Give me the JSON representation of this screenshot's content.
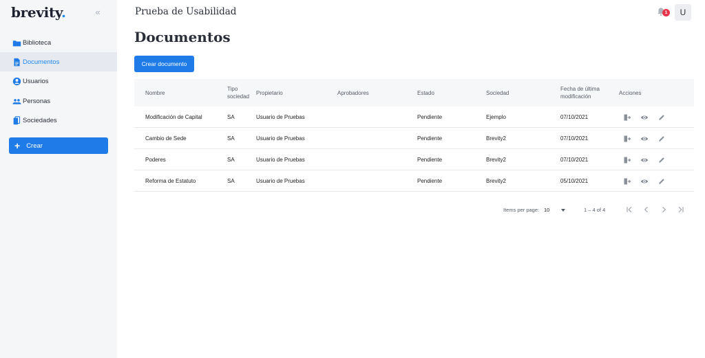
{
  "app": {
    "logo": "brevity",
    "logo_dot": ".",
    "collapse_icon": "«"
  },
  "sidebar": {
    "items": [
      {
        "label": "Biblioteca",
        "icon": "folder-icon"
      },
      {
        "label": "Documentos",
        "icon": "document-icon",
        "active": true
      },
      {
        "label": "Usuarios",
        "icon": "user-circle-icon"
      },
      {
        "label": "Personas",
        "icon": "people-icon"
      },
      {
        "label": "Sociedades",
        "icon": "copy-icon"
      }
    ],
    "create_label": "Crear",
    "create_icon": "+"
  },
  "header": {
    "title": "Prueba de Usabilidad",
    "notification_count": "1",
    "avatar_letter": "U"
  },
  "main": {
    "page_title": "Documentos",
    "create_doc_label": "Crear documento"
  },
  "table": {
    "columns": {
      "nombre": "Nombre",
      "tipo_line1": "Tipo",
      "tipo_line2": "sociedad",
      "propietario": "Propietario",
      "aprobadores": "Aprobadores",
      "estado": "Estado",
      "sociedad": "Sociedad",
      "fecha_line1": "Fecha de última",
      "fecha_line2": "modificación",
      "acciones": "Acciones"
    },
    "rows": [
      {
        "nombre": "Modificación de Capital",
        "tipo": "SA",
        "propietario": "Usuario de Pruebas",
        "aprobadores": "",
        "estado": "Pendiente",
        "sociedad": "Ejemplo",
        "fecha": "07/10/2021"
      },
      {
        "nombre": "Cambio de Sede",
        "tipo": "SA",
        "propietario": "Usuario de Pruebas",
        "aprobadores": "",
        "estado": "Pendiente",
        "sociedad": "Brevity2",
        "fecha": "07/10/2021"
      },
      {
        "nombre": "Poderes",
        "tipo": "SA",
        "propietario": "Usuario de Pruebas",
        "aprobadores": "",
        "estado": "Pendiente",
        "sociedad": "Brevity2",
        "fecha": "07/10/2021"
      },
      {
        "nombre": "Reforma de Estatuto",
        "tipo": "SA",
        "propietario": "Usuario de Pruebas",
        "aprobadores": "",
        "estado": "Pendiente",
        "sociedad": "Brevity2",
        "fecha": "05/10/2021"
      }
    ]
  },
  "paginator": {
    "items_per_page_label": "Items per page:",
    "items_per_page_value": "10",
    "range_label": "1 – 4 of 4"
  },
  "colors": {
    "accent": "#1e7be8",
    "badge": "#e8364d",
    "sidebar_bg": "#f5f6f8"
  }
}
